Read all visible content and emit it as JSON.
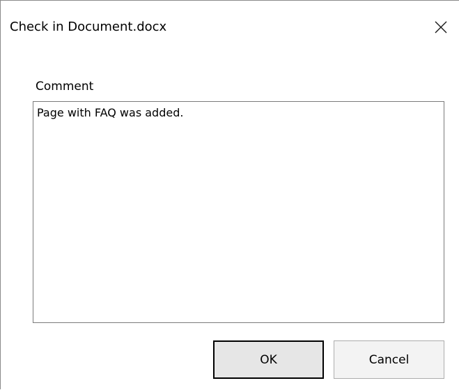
{
  "dialog": {
    "title": "Check in Document.docx",
    "close_icon": "close-icon",
    "comment_label": "Comment",
    "comment_value": "Page with FAQ was added.",
    "ok_label": "OK",
    "cancel_label": "Cancel"
  }
}
